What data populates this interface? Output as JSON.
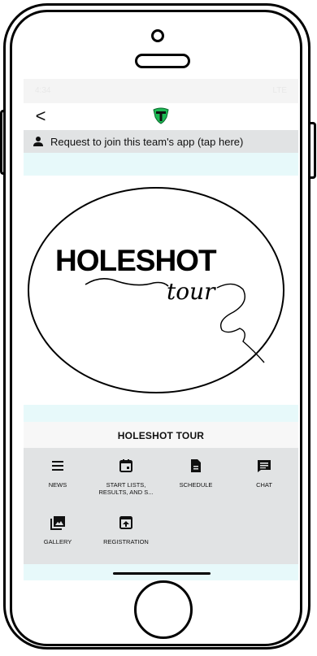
{
  "status_bar": {
    "time": "4:34",
    "indicators": "LTE"
  },
  "top_bar": {
    "back_label": "<",
    "logo_icon": "team-t-shield-icon",
    "logo_color": "#1db954"
  },
  "request_banner": {
    "icon": "person-icon",
    "text": "Request to join this team's app (tap here)"
  },
  "hero": {
    "logo_text": "HOLESHOT",
    "logo_script": "tour"
  },
  "team": {
    "name": "HOLESHOT TOUR"
  },
  "menu": {
    "items": [
      {
        "label": "NEWS",
        "icon": "news-icon"
      },
      {
        "label": "START LISTS, RESULTS, AND S...",
        "icon": "calendar-icon"
      },
      {
        "label": "SCHEDULE",
        "icon": "document-icon"
      },
      {
        "label": "CHAT",
        "icon": "chat-icon"
      },
      {
        "label": "GALLERY",
        "icon": "gallery-icon"
      },
      {
        "label": "REGISTRATION",
        "icon": "registration-icon"
      }
    ]
  },
  "colors": {
    "accent_band": "#e7f9fa",
    "menu_bg": "#e1e3e4",
    "brand_green": "#1db954"
  }
}
